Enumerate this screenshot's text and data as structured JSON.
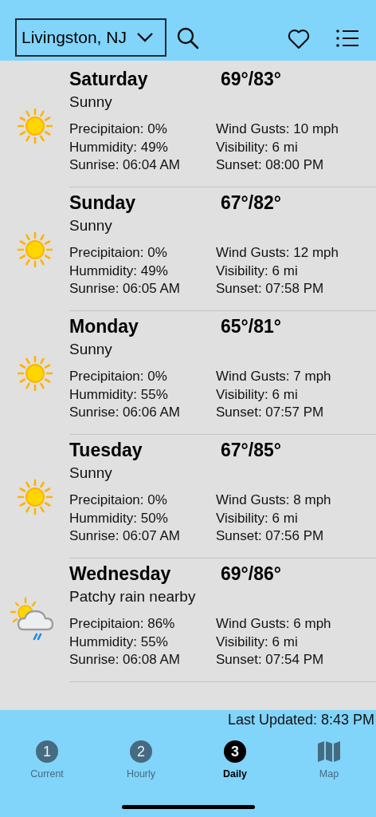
{
  "header": {
    "location": "Livingston, NJ"
  },
  "days": [
    {
      "name": "Saturday",
      "temps": "69°/83°",
      "condition": "Sunny",
      "kind": "sunny",
      "details": [
        "Precipitaion: 0%",
        "Wind Gusts: 10 mph",
        "Hummidity: 49%",
        "Visibility: 6 mi",
        "Sunrise: 06:04 AM",
        "Sunset: 08:00 PM"
      ]
    },
    {
      "name": "Sunday",
      "temps": "67°/82°",
      "condition": "Sunny",
      "kind": "sunny",
      "details": [
        "Precipitaion: 0%",
        "Wind Gusts: 12 mph",
        "Hummidity: 49%",
        "Visibility: 6 mi",
        "Sunrise: 06:05 AM",
        "Sunset: 07:58 PM"
      ]
    },
    {
      "name": "Monday",
      "temps": "65°/81°",
      "condition": "Sunny",
      "kind": "sunny",
      "details": [
        "Precipitaion: 0%",
        "Wind Gusts: 7 mph",
        "Hummidity: 55%",
        "Visibility: 6 mi",
        "Sunrise: 06:06 AM",
        "Sunset: 07:57 PM"
      ]
    },
    {
      "name": "Tuesday",
      "temps": "67°/85°",
      "condition": "Sunny",
      "kind": "sunny",
      "details": [
        "Precipitaion: 0%",
        "Wind Gusts: 8 mph",
        "Hummidity: 50%",
        "Visibility: 6 mi",
        "Sunrise: 06:07 AM",
        "Sunset: 07:56 PM"
      ]
    },
    {
      "name": "Wednesday",
      "temps": "69°/86°",
      "condition": "Patchy rain nearby",
      "kind": "patchy_rain",
      "details": [
        "Precipitaion: 86%",
        "Wind Gusts: 6 mph",
        "Hummidity: 55%",
        "Visibility: 6 mi",
        "Sunrise: 06:08 AM",
        "Sunset: 07:54 PM"
      ]
    }
  ],
  "last_updated": "Last Updated: 8:43 PM",
  "tabs": [
    {
      "kind": "number",
      "badge": "1",
      "label": "Current",
      "selected": false
    },
    {
      "kind": "number",
      "badge": "2",
      "label": "Hourly",
      "selected": false
    },
    {
      "kind": "number",
      "badge": "3",
      "label": "Daily",
      "selected": true
    },
    {
      "kind": "map",
      "label": "Map",
      "selected": false
    }
  ]
}
